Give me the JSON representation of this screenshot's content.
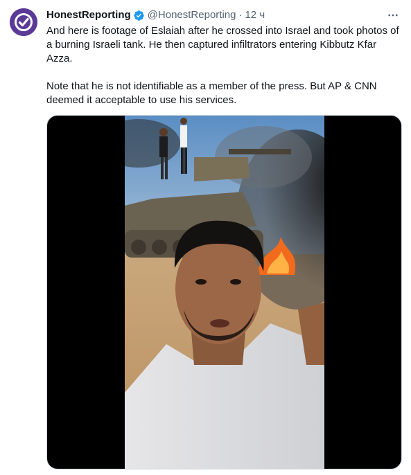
{
  "tweet": {
    "author": {
      "display_name": "HonestReporting",
      "handle": "@HonestReporting",
      "separator": "·",
      "time": "12 ч",
      "avatar_color": "#5b3a97",
      "verified_color": "#1d9bf0",
      "verified_icon": "verified-badge-icon"
    },
    "more_icon": "more-options-icon",
    "paragraphs": [
      "And here is footage of Eslaiah after he crossed into Israel and took photos of a burning Israeli tank. He then captured infiltrators entering Kibbutz Kfar Azza.",
      "Note that he is not identifiable as a member of the press. But AP & CNN deemed it acceptable to use his services."
    ],
    "media": {
      "kind": "video-frame",
      "letterbox_color": "#000000"
    }
  }
}
